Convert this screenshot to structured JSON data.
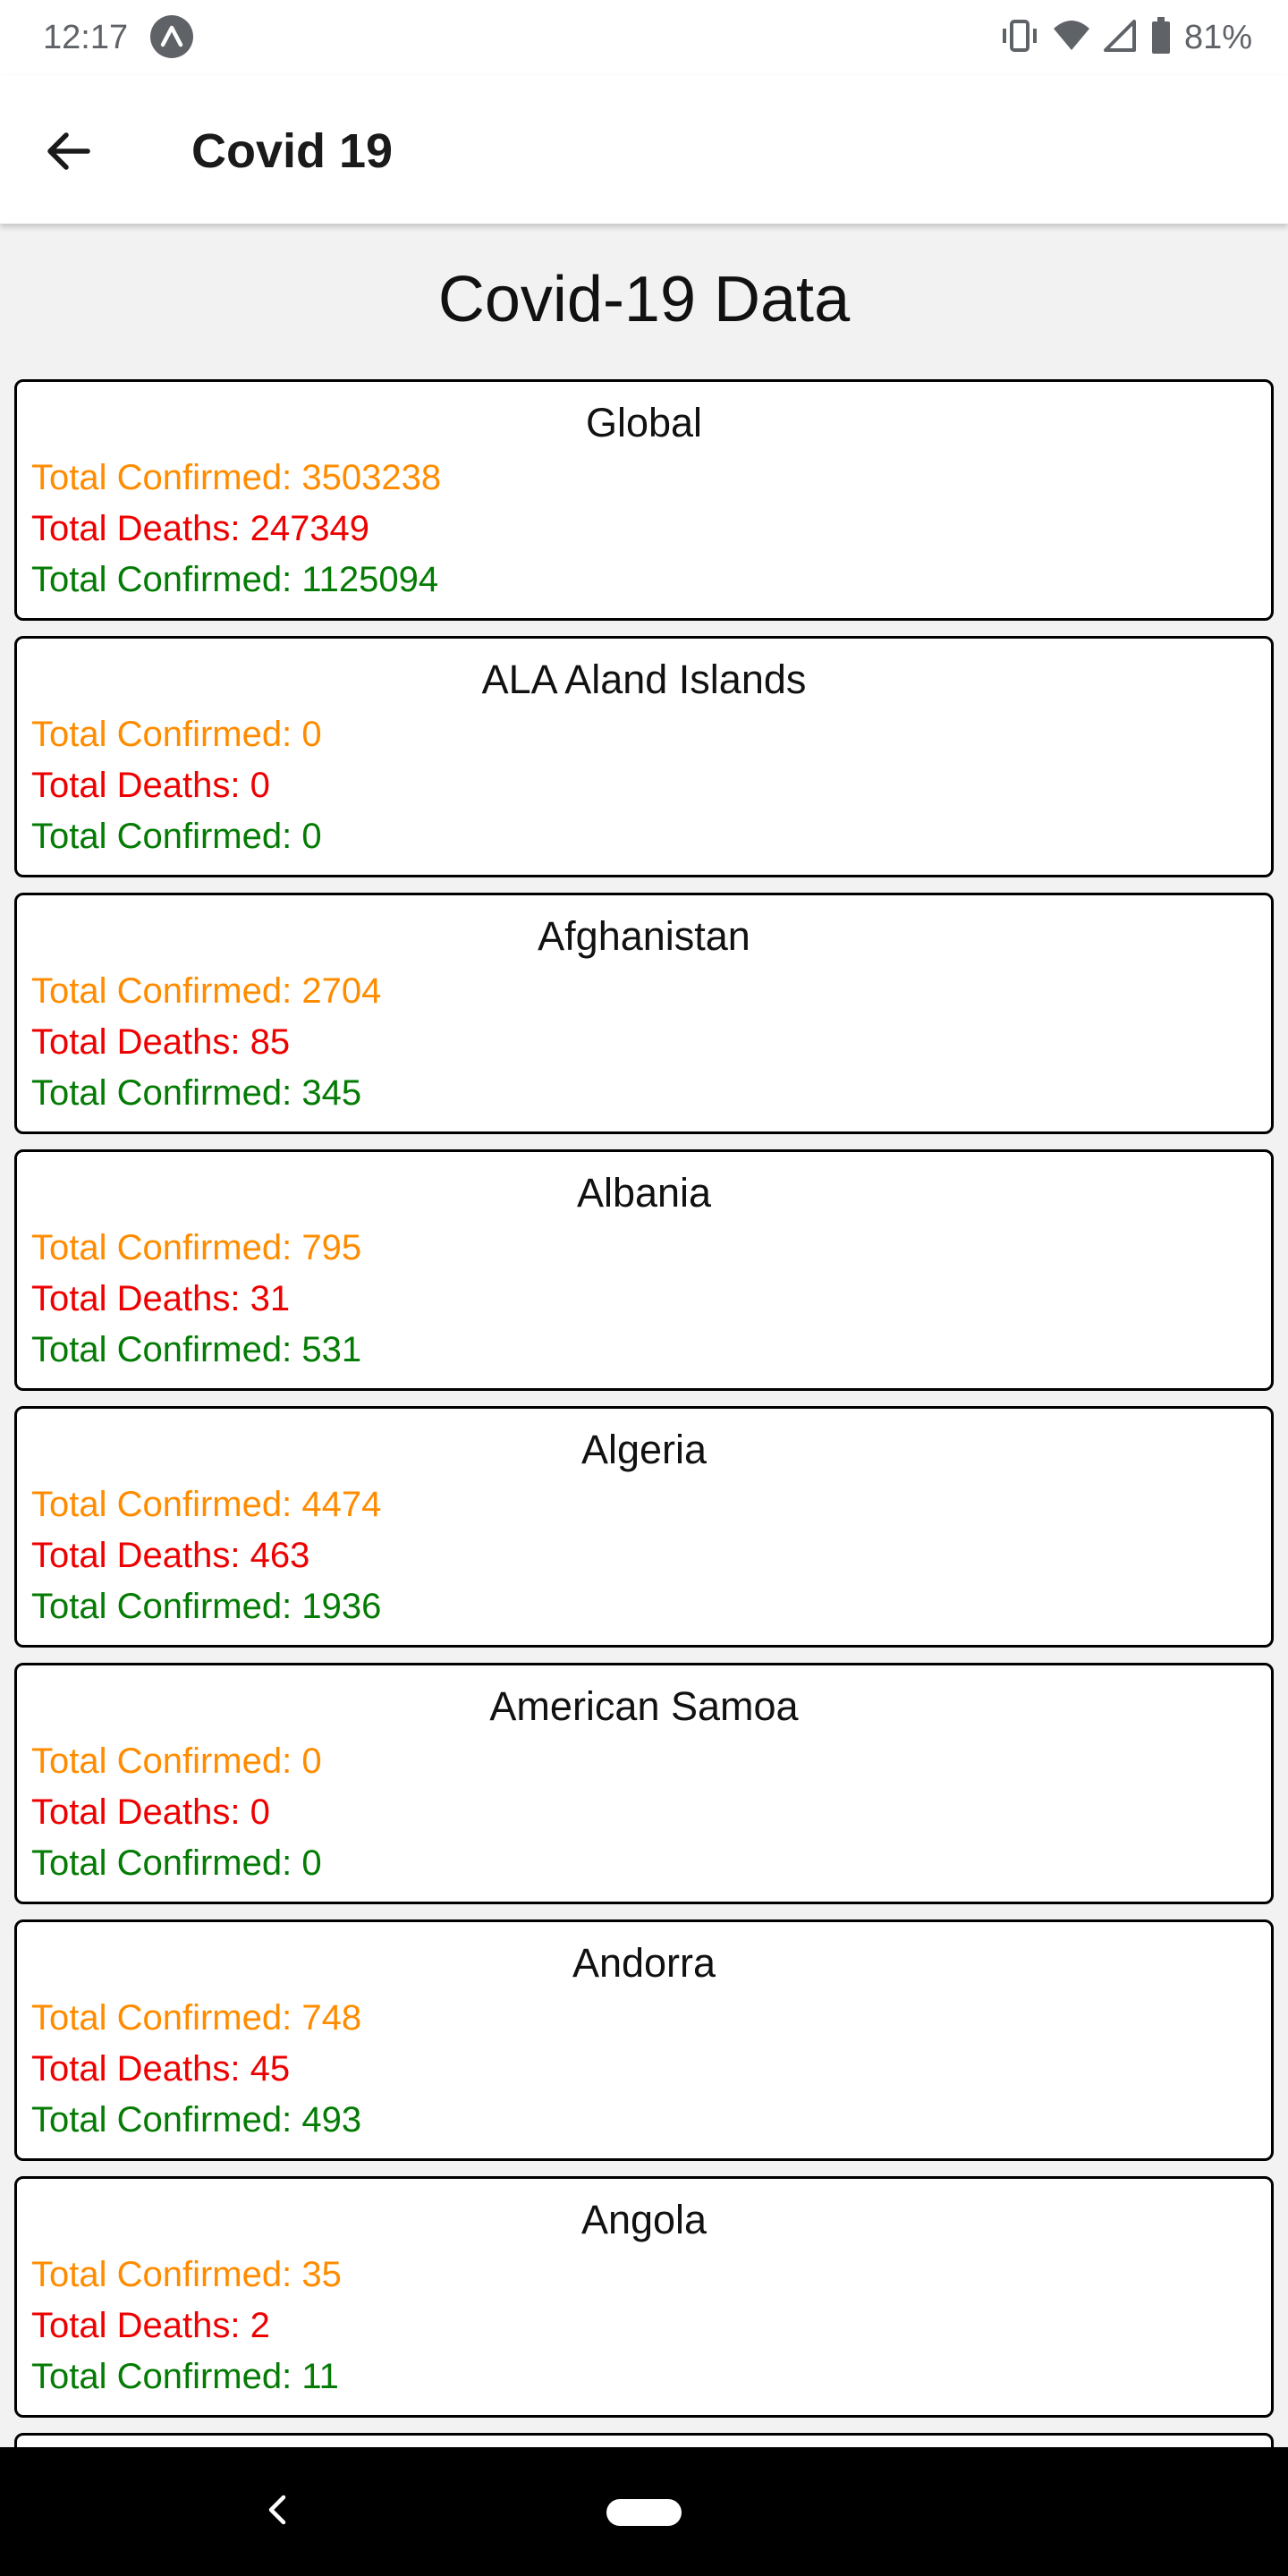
{
  "status_bar": {
    "time": "12:17",
    "battery_percent": "81%",
    "icons": [
      "app-notification-icon",
      "vibrate-icon",
      "wifi-icon",
      "cell-signal-icon",
      "battery-icon"
    ]
  },
  "app_bar": {
    "title": "Covid 19",
    "back_icon": "arrow-back-icon"
  },
  "page": {
    "heading": "Covid-19 Data"
  },
  "colors": {
    "confirmed": "#ff8c00",
    "deaths": "#ee0000",
    "recovered": "#047b04",
    "card_border": "#000000",
    "background": "#f2f2f2"
  },
  "cards": [
    {
      "name": "Global",
      "line1": "Total Confirmed: 3503238",
      "line2": "Total Deaths: 247349",
      "line3": "Total Confirmed: 1125094"
    },
    {
      "name": "ALA Aland Islands",
      "line1": "Total Confirmed: 0",
      "line2": "Total Deaths: 0",
      "line3": "Total Confirmed: 0"
    },
    {
      "name": "Afghanistan",
      "line1": "Total Confirmed: 2704",
      "line2": "Total Deaths: 85",
      "line3": "Total Confirmed: 345"
    },
    {
      "name": "Albania",
      "line1": "Total Confirmed: 795",
      "line2": "Total Deaths: 31",
      "line3": "Total Confirmed: 531"
    },
    {
      "name": "Algeria",
      "line1": "Total Confirmed: 4474",
      "line2": "Total Deaths: 463",
      "line3": "Total Confirmed: 1936"
    },
    {
      "name": "American Samoa",
      "line1": "Total Confirmed: 0",
      "line2": "Total Deaths: 0",
      "line3": "Total Confirmed: 0"
    },
    {
      "name": "Andorra",
      "line1": "Total Confirmed: 748",
      "line2": "Total Deaths: 45",
      "line3": "Total Confirmed: 493"
    },
    {
      "name": "Angola",
      "line1": "Total Confirmed: 35",
      "line2": "Total Deaths: 2",
      "line3": "Total Confirmed: 11"
    }
  ],
  "nav_bar": {
    "back_icon": "nav-back-icon",
    "home_icon": "nav-home-pill-icon"
  }
}
